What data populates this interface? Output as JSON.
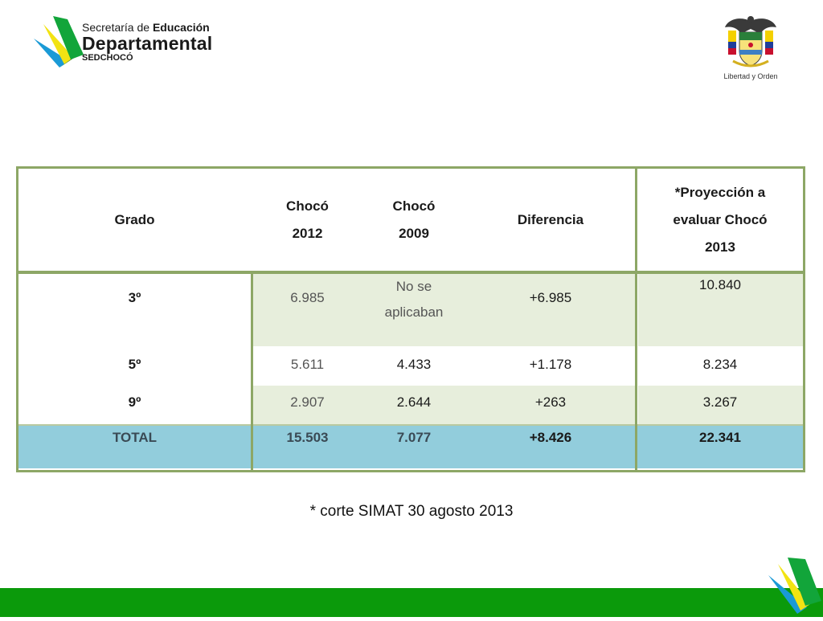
{
  "header": {
    "logo": {
      "line1_normal": "Secretaría de ",
      "line1_bold": "Educación",
      "line2": "Departamental",
      "line3": "SEDCHOCÓ"
    },
    "seal_caption": "Libertad y Orden"
  },
  "table": {
    "headers": {
      "grado": "Grado",
      "choco2012_a": "Chocó",
      "choco2012_b": "2012",
      "choco2009_a": "Chocó",
      "choco2009_b": "2009",
      "diferencia": "Diferencia",
      "proy_a": "*Proyección a",
      "proy_b": "evaluar Chocó",
      "proy_c": "2013"
    },
    "rows": [
      {
        "grado": "3º",
        "choco2012": "6.985",
        "choco2009_a": "No se",
        "choco2009_b": "aplicaban",
        "diferencia": "+6.985",
        "proyeccion": "10.840"
      },
      {
        "grado": "5º",
        "choco2012": "5.611",
        "choco2009": "4.433",
        "diferencia": "+1.178",
        "proyeccion": "8.234"
      },
      {
        "grado": "9º",
        "choco2012": "2.907",
        "choco2009": "2.644",
        "diferencia": "+263",
        "proyeccion": "3.267"
      }
    ],
    "total": {
      "grado": "TOTAL",
      "choco2012": "15.503",
      "choco2009": "7.077",
      "diferencia": "+8.426",
      "proyeccion": "22.341"
    }
  },
  "footnote": "* corte SIMAT 30 agosto 2013",
  "colors": {
    "table_border": "#8da766",
    "row_band": "#e7eedc",
    "total_row": "#92cddc",
    "footer_bar": "#0b9a0b"
  }
}
